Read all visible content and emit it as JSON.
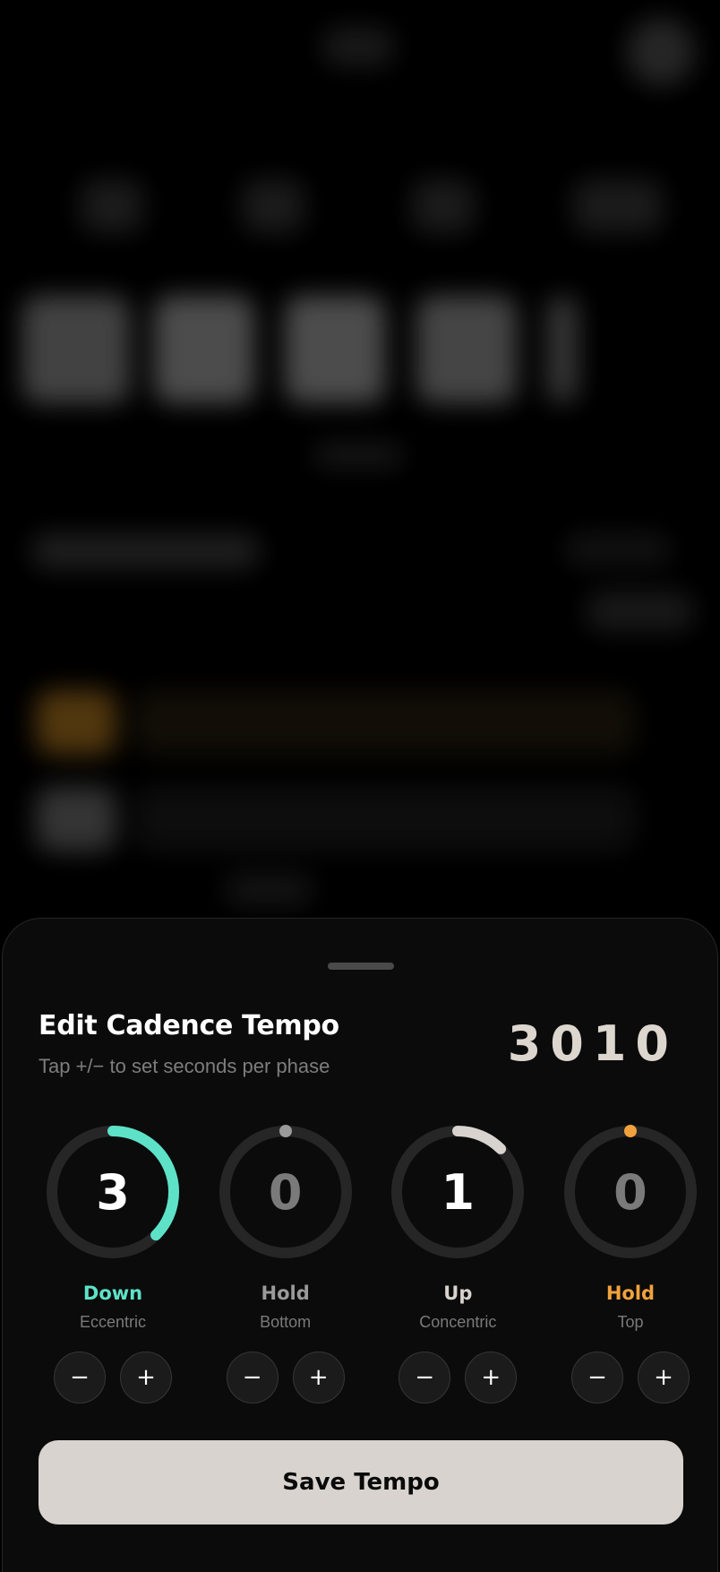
{
  "sheet": {
    "title": "Edit Cadence Tempo",
    "subtitle": "Tap +/− to set seconds per phase",
    "tempo_code": "3010",
    "save_label": "Save Tempo"
  },
  "phases": [
    {
      "value": "3",
      "name": "Down",
      "sub": "Eccentric",
      "accent": "#5de2c8",
      "fraction": 0.375,
      "minus": "−",
      "plus": "+"
    },
    {
      "value": "0",
      "name": "Hold",
      "sub": "Bottom",
      "accent": "#9a9a9a",
      "fraction": 0,
      "minus": "−",
      "plus": "+"
    },
    {
      "value": "1",
      "name": "Up",
      "sub": "Concentric",
      "accent": "#d8d3ce",
      "fraction": 0.125,
      "minus": "−",
      "plus": "+"
    },
    {
      "value": "0",
      "name": "Hold",
      "sub": "Top",
      "accent": "#f2a23c",
      "fraction": 0,
      "minus": "−",
      "plus": "+"
    }
  ],
  "colors": {
    "track": "#262626",
    "sheet_bg": "#0b0b0b",
    "save_bg": "#d8d3ce"
  }
}
